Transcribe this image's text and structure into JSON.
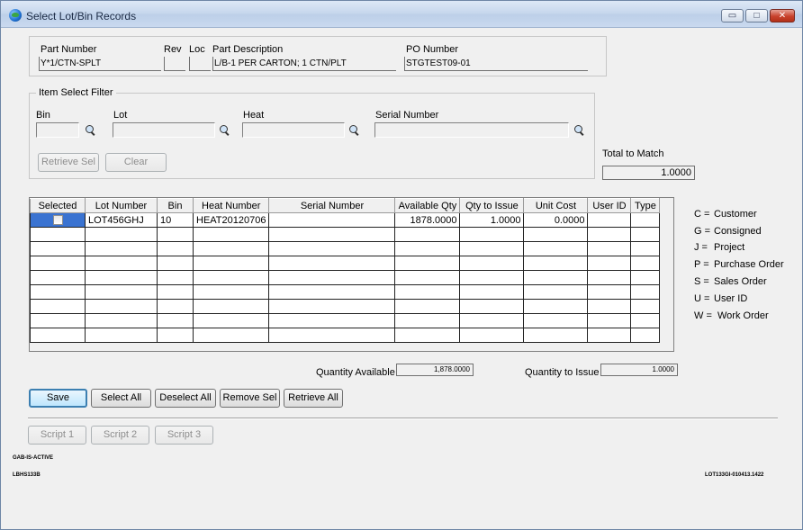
{
  "window": {
    "title": "Select Lot/Bin Records",
    "min_label": "▭",
    "max_label": "□",
    "close_label": "✕"
  },
  "header": {
    "part_number_label": "Part Number",
    "part_number": "Y*1/CTN-SPLT",
    "rev_label": "Rev",
    "rev": "",
    "loc_label": "Loc",
    "loc": "",
    "description_label": "Part Description",
    "description": "L/B-1 PER CARTON; 1 CTN/PLT",
    "po_label": "PO Number",
    "po_number": "STGTEST09-01"
  },
  "filter": {
    "title": "Item Select Filter",
    "bin_label": "Bin",
    "lot_label": "Lot",
    "heat_label": "Heat",
    "serial_label": "Serial Number",
    "retrieve_sel_label": "Retrieve Sel",
    "clear_label": "Clear"
  },
  "total": {
    "label": "Total to Match",
    "value": "1.0000"
  },
  "grid": {
    "columns": [
      "Selected",
      "Lot Number",
      "Bin",
      "Heat Number",
      "Serial Number",
      "Available Qty",
      "Qty to Issue",
      "Unit Cost",
      "User ID",
      "Type"
    ],
    "rows": [
      {
        "selected": false,
        "lot": "LOT456GHJ",
        "bin": "10",
        "heat": "HEAT20120706",
        "serial": "",
        "available": "1878.0000",
        "issue": "1.0000",
        "cost": "0.0000",
        "user": "",
        "type": ""
      }
    ]
  },
  "type_legend": [
    {
      "code": "C =",
      "text": "Customer"
    },
    {
      "code": "G =",
      "text": "Consigned"
    },
    {
      "code": "J =",
      "text": "Project"
    },
    {
      "code": "P =",
      "text": "Purchase Order"
    },
    {
      "code": "S =",
      "text": "Sales Order"
    },
    {
      "code": "U =",
      "text": "User ID"
    },
    {
      "code": "W =",
      "text": "Work Order"
    }
  ],
  "quantities": {
    "available_label": "Quantity Available",
    "available_value": "1,878.0000",
    "issue_label": "Quantity to Issue",
    "issue_value": "1.0000"
  },
  "actions": {
    "save": "Save",
    "select_all": "Select All",
    "deselect_all": "Deselect All",
    "remove_sel": "Remove Sel",
    "retrieve_all": "Retrieve All",
    "script1": "Script 1",
    "script2": "Script 2",
    "script3": "Script 3"
  },
  "footer": {
    "status_active": "GAB-IS-ACTIVE",
    "screen_id": "LBHS133B",
    "version": "LOT133GI-010413.1422"
  }
}
